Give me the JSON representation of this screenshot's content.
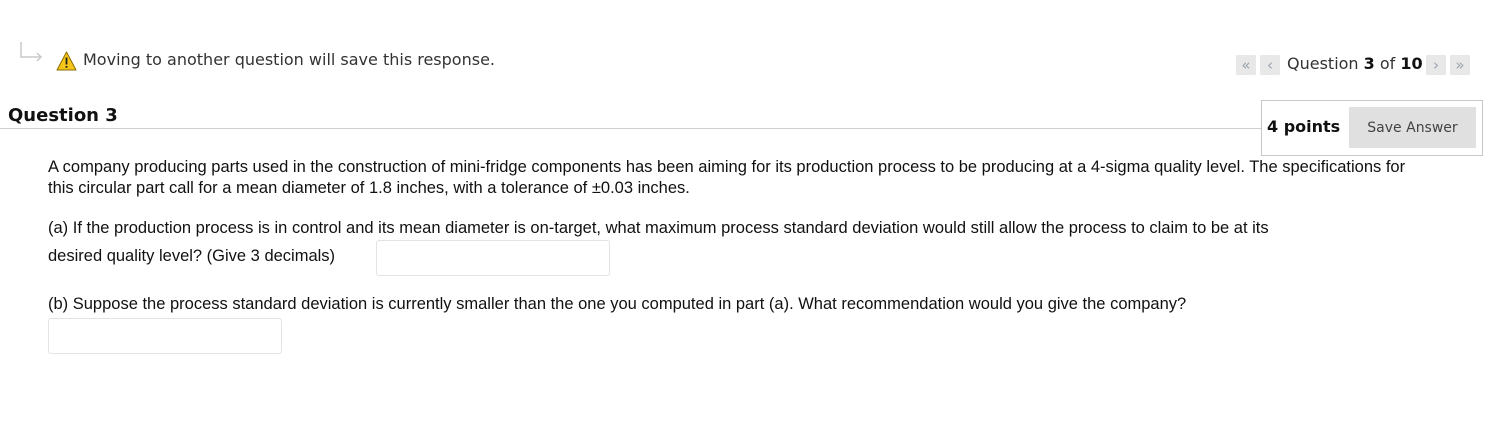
{
  "notice": {
    "arrow_icon": "return-arrow-icon",
    "warning_icon": "warning-triangle-icon",
    "text": "Moving to another question will save this response."
  },
  "navigation": {
    "first_glyph": "«",
    "prev_glyph": "‹",
    "next_glyph": "›",
    "last_glyph": "»",
    "prefix": "Question",
    "current": "3",
    "of_label": "of",
    "total": "10"
  },
  "question": {
    "title": "Question 3",
    "points": "4 points",
    "save_label": "Save Answer",
    "paragraph_intro": "A company producing parts used in the construction of mini-fridge components has been aiming for its production process to be producing at a 4-sigma quality level. The specifications for this circular part call for a mean diameter of 1.8 inches, with a tolerance of ±0.03 inches.",
    "part_a_line1": "(a)  If the production process is in control and its mean diameter is on-target, what maximum process standard deviation would still allow the process to claim to be at its",
    "part_a_line2": "desired quality level?  (Give 3 decimals)",
    "part_a_answer": "",
    "part_b": "(b) Suppose the process standard deviation is currently smaller than the one you computed in part (a).  What recommendation would you give the company?",
    "part_b_answer": ""
  },
  "colors": {
    "warning_yellow": "#f5c518",
    "nav_button_bg": "#e8e8e8",
    "save_button_bg": "#e0e0e0",
    "rule": "#cfcfcf"
  }
}
